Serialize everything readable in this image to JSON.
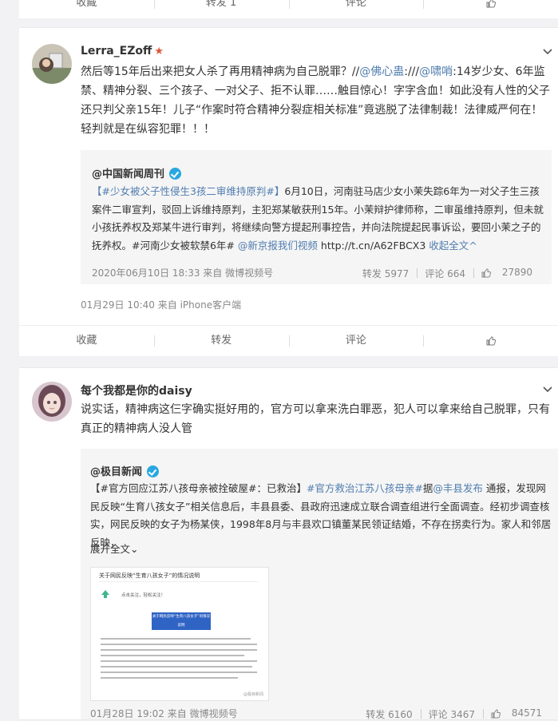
{
  "top_actions": {
    "collect": "收藏",
    "repost": "转发 1",
    "comment": "评论"
  },
  "post1": {
    "username": "Lerra_EZoff",
    "text_a": "然后等15年后出来把女人杀了再用精神病为自己脱罪？//",
    "mention1": "@佛心蛊",
    "text_b": ":///",
    "mention2": "@啸哨",
    "text_c": ":14岁少女、6年监禁、精神分裂、三个孩子、一对父子、拒不认罪……触目惊心！字字含血！如此没有人性的父子还只判父亲15年！儿子“作案时符合精神分裂症相关标准”竟逃脱了法律制裁！法律威严何在！轻判就是在纵容犯罪！！！",
    "quote": {
      "source": "@中国新闻周刊",
      "hashtag": "【#少女被父子性侵生3孩二审维持原判#】",
      "body": "6月10日，河南驻马店少女小茉失踪6年为一对父子生三孩案件二审宣判，驳回上诉维持原判，主犯郑某敏获刑15年。小茉辩护律师称，二审虽维持原判，但未就小孩抚养权及郑某牛进行审判，将继续向警方提起刑事控告，并向法院提起民事诉讼，要回小茉之子的抚养权。#河南少女被软禁6年#",
      "mention": "@新京报我们视频",
      "url": "http://t.cn/A62FBCX3",
      "collapse": "收起全文",
      "time": "2020年06月10日 18:33 来自 微博视频号",
      "repost": "转发 5977",
      "comment": "评论 664",
      "like": "27890"
    },
    "time": "01月29日 10:40  来自 iPhone客户端",
    "actions": {
      "collect": "收藏",
      "repost": "转发",
      "comment": "评论"
    }
  },
  "post2": {
    "username": "每个我都是你的daisy",
    "text": "说实话，精神病这仨字确实挺好用的，官方可以拿来洗白罪恶，犯人可以拿来给自己脱罪，只有真正的精神病人没人管",
    "quote": {
      "source": "@极目新闻",
      "hashtag1": "【#官方回应江苏八孩母亲被拴破屋#：已救治】",
      "hashtag2": "#官方救治江苏八孩母亲#",
      "ju": "据",
      "mention": "@丰县发布",
      "body": " 通报，发现网民反映“生育八孩女子”相关信息后，丰县县委、县政府迅速成立联合调查组进行全面调查。经初步调查核实，网民反映的女子为杨某侠，1998年8月与丰县欢口镇董某民领证结婚，不存在拐卖行为。家人和邻居反映，",
      "expand": "展开全文",
      "image": {
        "title": "关于网民反映“生育八孩女子”的情况说明",
        "follow": "点击关注，轻松关注！",
        "banner": "关于网民反映“生育八孩女子”的情况说明",
        "watermark": "@极目新闻"
      },
      "time": "01月28日 19:02 来自 微博视频号",
      "repost": "转发 6160",
      "comment": "评论 3467",
      "like": "84571"
    }
  },
  "colors": {
    "accent": "#eb7350",
    "link": "#507daf",
    "verified": "#28a7e1",
    "star": "#e2543a"
  }
}
